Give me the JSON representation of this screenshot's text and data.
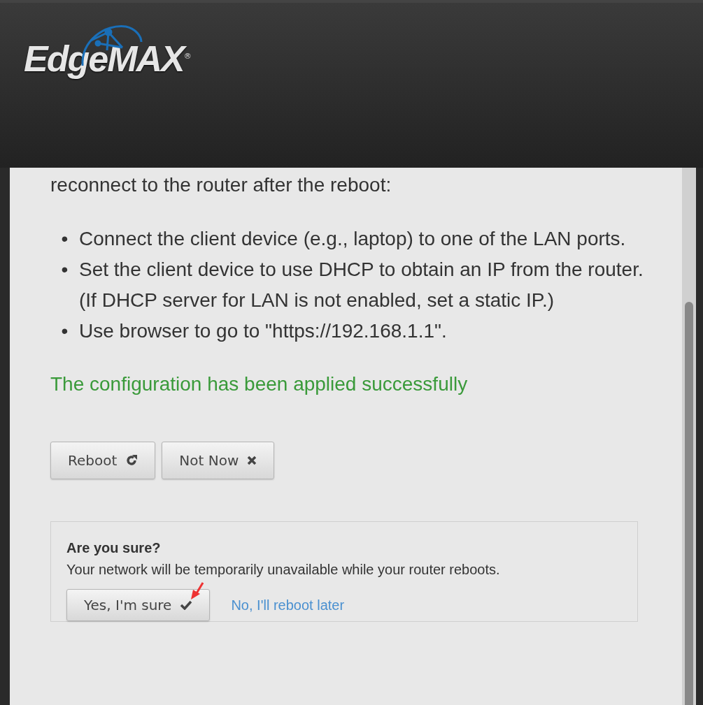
{
  "header": {
    "logo": "EdgeMAX",
    "logo_mark": "®"
  },
  "content": {
    "intro": "reconnect to the router after the reboot:",
    "steps": [
      {
        "bullet": "•",
        "text": "Connect the client device (e.g., laptop) to one of the LAN ports."
      },
      {
        "bullet": "•",
        "text": "Set the client device to use DHCP to obtain an IP from the router. (If DHCP server for LAN is not enabled, set a static IP.)"
      },
      {
        "bullet": "•",
        "text": "Use browser to go to \"https://192.168.1.1\"."
      }
    ],
    "success": "The configuration has been applied successfully",
    "buttons": [
      {
        "label": "Reboot",
        "kind": "reboot"
      },
      {
        "label": "Not Now",
        "kind": "close"
      }
    ],
    "confirm": {
      "title": "Are you sure?",
      "message": "Your network will be temporarily unavailable while your router reboots.",
      "yes": "Yes, I'm sure",
      "no": "No, I'll reboot later"
    }
  }
}
